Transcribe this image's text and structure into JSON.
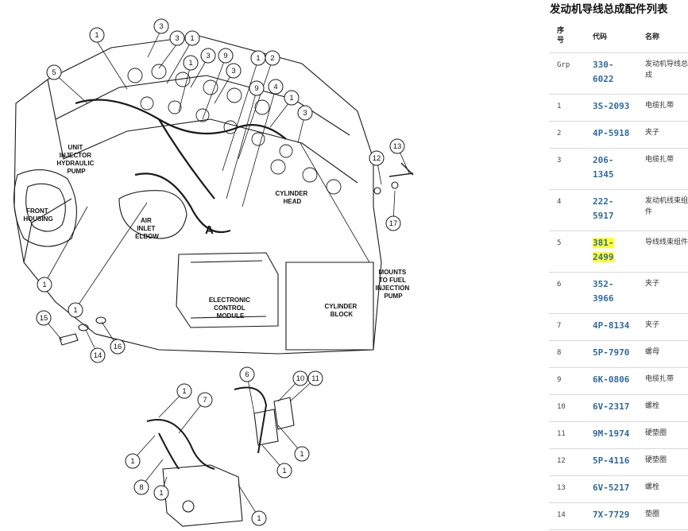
{
  "diagram": {
    "labels": {
      "unit_injector_pump": [
        "UNIT",
        "INJECTOR",
        "HYDRAULIC",
        "PUMP"
      ],
      "front_housing": [
        "FRONT",
        "HOUSING"
      ],
      "air_inlet_elbow": [
        "AIR",
        "INLET",
        "ELBOW"
      ],
      "cylinder_head": [
        "CYLINDER",
        "HEAD"
      ],
      "electronic_control_module": [
        "ELECTRONIC",
        "CONTROL",
        "MODULE"
      ],
      "cylinder_block": [
        "CYLINDER",
        "BLOCK"
      ],
      "mounts_to_pump": [
        "MOUNTS",
        "TO FUEL",
        "INJECTION",
        "PUMP"
      ],
      "view_a": "A"
    }
  },
  "panel": {
    "title": "发动机导线总成配件列表",
    "headers": {
      "seq": [
        "序",
        "号"
      ],
      "code": "代码",
      "name": "名称"
    },
    "rows": [
      {
        "seq": "Grp",
        "code": [
          "330-",
          "6022"
        ],
        "name": [
          "发动机导线总",
          "成"
        ]
      },
      {
        "seq": "1",
        "code": [
          "3S-2093"
        ],
        "name": [
          "电缆扎带"
        ]
      },
      {
        "seq": "2",
        "code": [
          "4P-5918"
        ],
        "name": [
          "夹子"
        ]
      },
      {
        "seq": "3",
        "code": [
          "206-",
          "1345"
        ],
        "name": [
          "电缆扎带"
        ]
      },
      {
        "seq": "4",
        "code": [
          "222-",
          "5917"
        ],
        "name": [
          "发动机线束组",
          "件"
        ]
      },
      {
        "seq": "5",
        "code": [
          "381-",
          "2499"
        ],
        "name": [
          "导线线束组件"
        ],
        "highlight": true
      },
      {
        "seq": "6",
        "code": [
          "352-",
          "3966"
        ],
        "name": [
          "夹子"
        ]
      },
      {
        "seq": "7",
        "code": [
          "4P-8134"
        ],
        "name": [
          "夹子"
        ]
      },
      {
        "seq": "8",
        "code": [
          "5P-7970"
        ],
        "name": [
          "螺母"
        ]
      },
      {
        "seq": "9",
        "code": [
          "6K-0806"
        ],
        "name": [
          "电缆扎带"
        ]
      },
      {
        "seq": "10",
        "code": [
          "6V-2317"
        ],
        "name": [
          "螺栓"
        ]
      },
      {
        "seq": "11",
        "code": [
          "9M-1974"
        ],
        "name": [
          "硬垫圈"
        ]
      },
      {
        "seq": "12",
        "code": [
          "5P-4116"
        ],
        "name": [
          "硬垫圈"
        ]
      },
      {
        "seq": "13",
        "code": [
          "6V-5217"
        ],
        "name": [
          "螺栓"
        ]
      },
      {
        "seq": "14",
        "code": [
          "7X-7729"
        ],
        "name": [
          "垫圈"
        ]
      }
    ]
  },
  "callouts": [
    "1",
    "2",
    "3",
    "4",
    "5",
    "6",
    "7",
    "8",
    "9",
    "10",
    "11",
    "12",
    "13",
    "14",
    "15",
    "16",
    "17"
  ]
}
